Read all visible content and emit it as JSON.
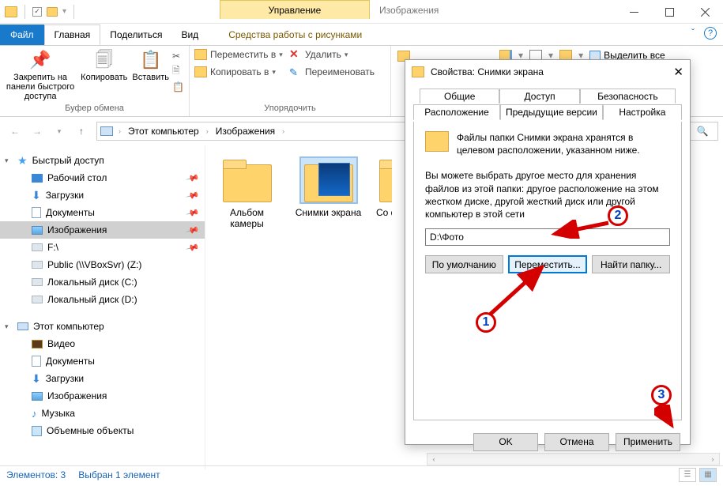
{
  "titlebar": {
    "context_tab": "Управление",
    "window_title": "Изображения"
  },
  "ribbon_tabs": {
    "file": "Файл",
    "home": "Главная",
    "share": "Поделиться",
    "view": "Вид",
    "context": "Средства работы с рисунками"
  },
  "ribbon": {
    "pin": "Закрепить на панели быстрого доступа",
    "copy": "Копировать",
    "paste": "Вставить",
    "clipboard_group": "Буфер обмена",
    "move_to": "Переместить в",
    "copy_to": "Копировать в",
    "delete": "Удалить",
    "rename": "Переименовать",
    "organize_group": "Упорядочить",
    "select_all": "Выделить все"
  },
  "breadcrumb": {
    "this_pc": "Этот компьютер",
    "pictures": "Изображения"
  },
  "nav": {
    "quick_access": "Быстрый доступ",
    "desktop": "Рабочий стол",
    "downloads": "Загрузки",
    "documents": "Документы",
    "pictures": "Изображения",
    "drive_f": "F:\\",
    "public": "Public (\\\\VBoxSvr) (Z:)",
    "local_c": "Локальный диск (C:)",
    "local_d": "Локальный диск (D:)",
    "this_pc": "Этот компьютер",
    "video": "Видео",
    "documents2": "Документы",
    "downloads2": "Загрузки",
    "pictures2": "Изображения",
    "music": "Музыка",
    "objects3d": "Объемные объекты"
  },
  "files": {
    "camera_roll": "Альбом камеры",
    "screenshots": "Снимки экрана",
    "saved": "Со ф"
  },
  "status": {
    "count": "Элементов: 3",
    "selected": "Выбран 1 элемент"
  },
  "dialog": {
    "title": "Свойства: Снимки экрана",
    "tabs": {
      "general": "Общие",
      "access": "Доступ",
      "security": "Безопасность",
      "location": "Расположение",
      "prev": "Предыдущие версии",
      "customize": "Настройка"
    },
    "desc1": "Файлы папки Снимки экрана хранятся в целевом расположении, указанном ниже.",
    "desc2": "Вы можете выбрать другое место для хранения файлов из этой папки: другое расположение на этом жестком диске, другой жесткий диск или другой компьютер в этой сети",
    "path": "D:\\Фото",
    "btn_default": "По умолчанию",
    "btn_move": "Переместить...",
    "btn_find": "Найти папку...",
    "btn_ok": "OK",
    "btn_cancel": "Отмена",
    "btn_apply": "Применить"
  },
  "annotations": {
    "n1": "1",
    "n2": "2",
    "n3": "3"
  }
}
